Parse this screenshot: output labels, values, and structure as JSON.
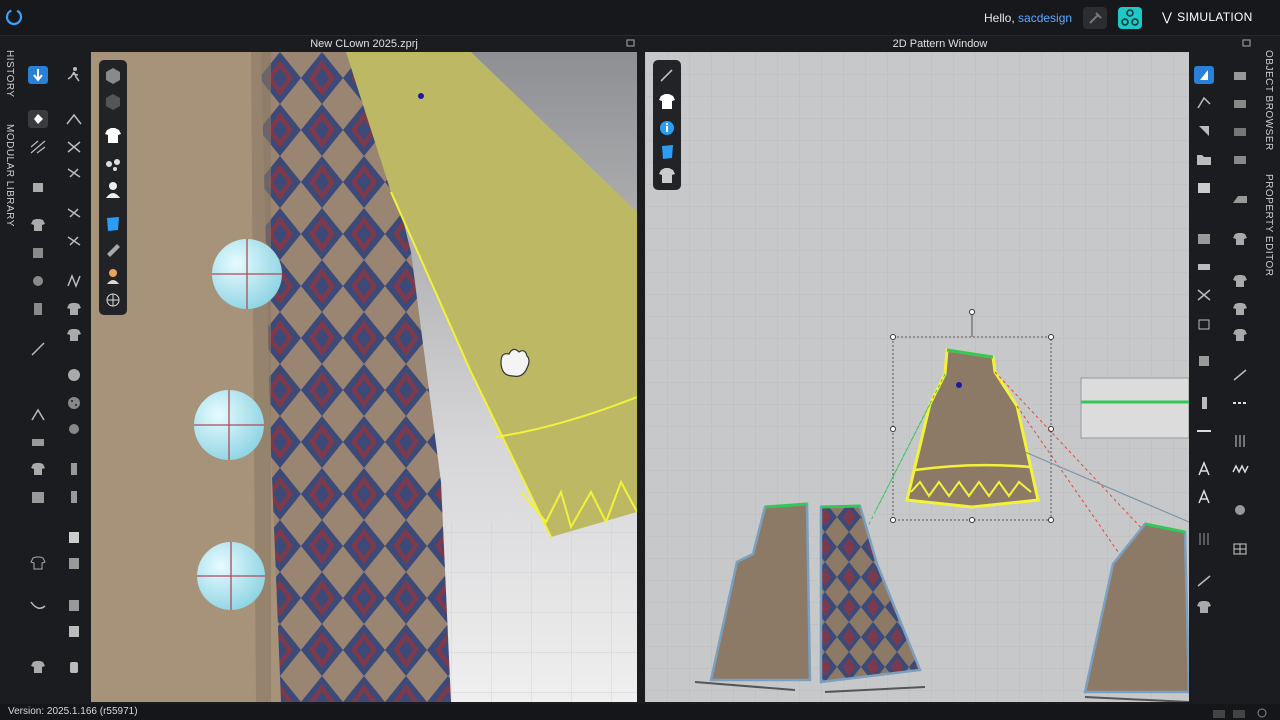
{
  "header": {
    "greeting": "Hello,",
    "username": "sacdesign",
    "mode_label": "SIMULATION"
  },
  "side_tabs": {
    "left": [
      "HISTORY",
      "MODULAR LIBRARY"
    ],
    "right": [
      "OBJECT BROWSER",
      "PROPERTY EDITOR"
    ]
  },
  "panels": {
    "view3d_title": "New CLown 2025.zprj",
    "view2d_title": "2D Pattern Window"
  },
  "status": {
    "version": "Version: 2025.1.166 (r55971)"
  },
  "colors": {
    "accent": "#5aa9ff",
    "active_tool": "#2a7fd6",
    "cloth_tan": "#a6937a",
    "cloth_yellow": "#bdb864",
    "pattern_fill": "#8c7a66",
    "selection_yellow": "#f2f23a",
    "seam_green": "#35c65a",
    "seam_red": "#e24a38"
  }
}
